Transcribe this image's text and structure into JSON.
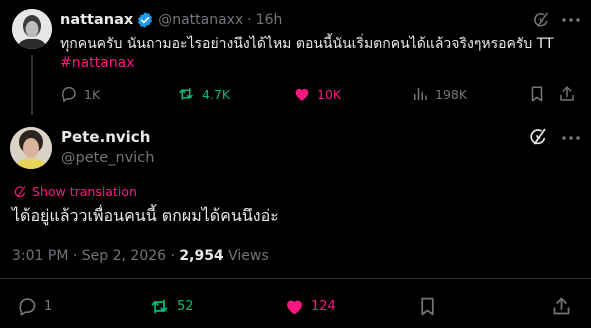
{
  "colors": {
    "background": "#000000",
    "primary_text": "#e7e9ea",
    "secondary_text": "#71767b",
    "accent_pink": "#f91880",
    "retweet_green": "#00ba7c",
    "verified_blue": "#1d9bf0",
    "divider": "#2f3336"
  },
  "parent_tweet": {
    "display_name": "nattanax",
    "handle": "@nattanaxx",
    "separator": "·",
    "time": "16h",
    "text": "ทุกคนครับ นันถามอะไรอย่างนึงได้ไหม ตอนนี้นันเริ่มตกคนได้แล้วจริงๆหรอครับ TT",
    "hashtag": "#nattanax",
    "icons": {
      "avatar": "profile-photo",
      "verified": "verified-badge-icon",
      "grok": "grok-icon",
      "more": "more-options-icon"
    },
    "actions": {
      "replies": "1K",
      "reposts": "4.7K",
      "likes": "10K",
      "views": "198K"
    }
  },
  "main_tweet": {
    "display_name": "Pete.nvich",
    "handle": "@pete_nvich",
    "translation_label": "Show translation",
    "text": "ได้อยู่แล้ววเพื่อนคนนี้ ตกผมได้คนนึงอ่ะ",
    "timestamp": "3:01 PM · Sep 2, 2026 · ",
    "views_count": "2,954",
    "views_label": " Views",
    "icons": {
      "avatar": "profile-photo",
      "grok": "grok-icon",
      "more": "more-options-icon",
      "translate": "globe-icon"
    },
    "actions": {
      "replies": "1",
      "reposts": "52",
      "likes": "124"
    }
  }
}
